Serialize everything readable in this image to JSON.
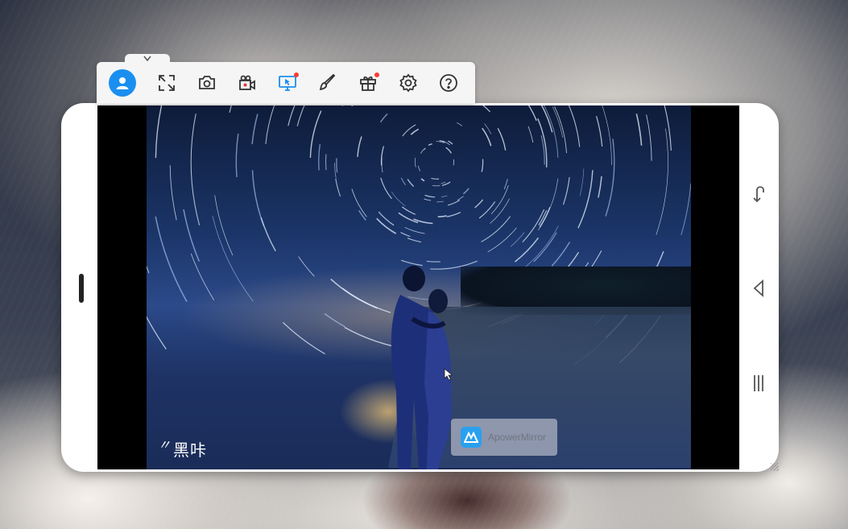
{
  "app": {
    "name": "ApowerMirror"
  },
  "toolbar": {
    "buttons": [
      {
        "name": "account",
        "icon": "user-icon"
      },
      {
        "name": "fullscreen",
        "icon": "fullscreen-icon"
      },
      {
        "name": "screenshot",
        "icon": "camera-icon"
      },
      {
        "name": "record",
        "icon": "video-camera-icon"
      },
      {
        "name": "screen-cast",
        "icon": "monitor-cursor-icon",
        "active": true,
        "badge": true
      },
      {
        "name": "whiteboard",
        "icon": "brush-icon"
      },
      {
        "name": "gift",
        "icon": "gift-icon",
        "badge": true
      },
      {
        "name": "settings",
        "icon": "gear-icon"
      },
      {
        "name": "help",
        "icon": "help-icon"
      }
    ],
    "accent": "#1a8ff0",
    "badge_color": "#ff3b30"
  },
  "video": {
    "watermark": "黑咔",
    "watermark_mark": "〃"
  },
  "overlay": {
    "badge_text": "ApowerMirror"
  },
  "phone_nav": {
    "buttons": [
      "back-icon",
      "home-icon",
      "recent-apps-icon"
    ]
  }
}
